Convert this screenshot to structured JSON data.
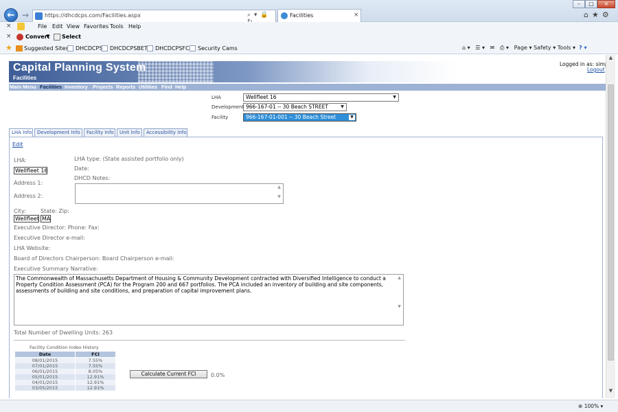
{
  "browser": {
    "url": "https://dhcdcps.com/Facilities.aspx",
    "tab_title": "Facilities",
    "window_controls": {
      "minimize": "–",
      "maximize": "□",
      "close": "×"
    },
    "menus": [
      "File",
      "Edit",
      "View",
      "Favorites",
      "Tools",
      "Help"
    ],
    "toolbar": {
      "convert_label": "Convert",
      "select_label": "Select"
    },
    "favorites": [
      "Suggested Sites ▾",
      "DHCDCPS",
      "DHCDCPSBETA",
      "DHCDCPSFCA",
      "Security Cams"
    ],
    "command_bar": "Page ▾   Safety ▾   Tools ▾",
    "zoom": "100%"
  },
  "header": {
    "app_title": "Capital Planning System",
    "section_title": "Facilities",
    "logged_in_text": "Logged in as: simp",
    "logout_label": "Logout"
  },
  "nav": [
    "Main Menu",
    "Facilities",
    "Inventory",
    "Projects",
    "Reports",
    "Utilities",
    "Find",
    "Help"
  ],
  "nav_active": "Facilities",
  "selectors": {
    "lha_label": "LHA",
    "lha_value": "Wellfleet 16",
    "development_label": "Development",
    "development_value": "966-167-01 -- 30 Beach STREET",
    "facility_label": "Facility",
    "facility_value": "966-167-01-001 -- 30 Beach Street"
  },
  "tabs": [
    "LHA Info",
    "Development Info",
    "Facility Info",
    "Unit Info",
    "Accessibility Info"
  ],
  "active_tab": "LHA Info",
  "lha_info": {
    "edit_label": "Edit",
    "lha_label": "LHA:",
    "lha_value": "Wellfleet 16",
    "lha_type_label": "LHA type: (State assisted portfolio only)",
    "date_label": "Date:",
    "dhcd_notes_label": "DHCD Notes:",
    "address1_label": "Address 1:",
    "address2_label": "Address 2:",
    "city_label": "City:",
    "state_zip_label": "State: Zip:",
    "city_value": "Wellfleet",
    "state_value": "MA",
    "exec_director_label": "Executive Director: Phone: Fax:",
    "exec_email_label": "Executive Director e-mail:",
    "website_label": "LHA Website:",
    "board_label": "Board of Directors Chairperson: Board Chairperson e-mail:",
    "narrative_label": "Executive Summary Narrative:",
    "narrative_text": "The Commonwealth of Massachusetts Department of Housing & Community Development contracted with Diversified Intelligence to conduct a Property Condition Assessment (PCA) for the Program 200 and 667 portfolios. The PCA included an inventory of building and site components, assessments of building and site conditions, and preparation of capital improvement plans.",
    "dwelling_units": "Total Number of Dwelling Units: 263"
  },
  "fci": {
    "caption": "Facility Condition Index History",
    "columns": [
      "Date",
      "FCI"
    ],
    "rows": [
      [
        "08/01/2015",
        "7.55%"
      ],
      [
        "07/01/2015",
        "7.55%"
      ],
      [
        "06/01/2015",
        "8.05%"
      ],
      [
        "05/01/2015",
        "12.91%"
      ],
      [
        "04/01/2015",
        "12.91%"
      ],
      [
        "03/05/2015",
        "12.91%"
      ]
    ],
    "calc_button": "Calculate Current FCI",
    "current_value": "0.0%"
  }
}
